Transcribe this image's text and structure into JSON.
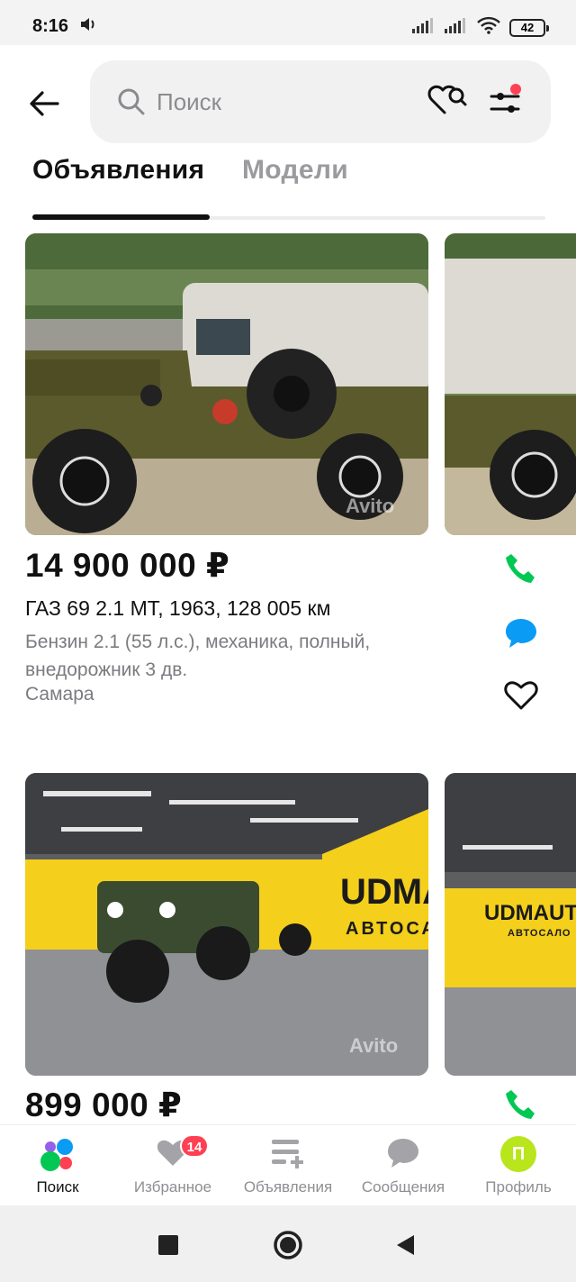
{
  "status_bar": {
    "time": "8:16",
    "battery": "42"
  },
  "search": {
    "placeholder": "Поиск"
  },
  "tabs": [
    {
      "label": "Объявления",
      "active": true
    },
    {
      "label": "Модели",
      "active": false
    }
  ],
  "listings": [
    {
      "price": "14 900 000 ₽",
      "title": "ГАЗ 69 2.1 MT, 1963, 128 005 км",
      "description": "Бензин 2.1 (55 л.с.), механика, полный, внедорожник 3 дв.",
      "location": "Самара",
      "watermark": "Avito"
    },
    {
      "price": "899 000 ₽",
      "banner_text": "UDMA",
      "banner_subtext": "АВТОСА",
      "banner_text_2": "UDMAUT",
      "banner_subtext_2": "АВТОСАЛО",
      "watermark": "Avito"
    }
  ],
  "bottom_nav": [
    {
      "label": "Поиск",
      "active": true
    },
    {
      "label": "Избранное",
      "badge": "14"
    },
    {
      "label": "Объявления"
    },
    {
      "label": "Сообщения"
    },
    {
      "label": "Профиль",
      "avatar_letter": "П"
    }
  ],
  "colors": {
    "call_green": "#00c853",
    "message_blue": "#0a9bf5",
    "badge_red": "#ff4053",
    "avatar_green": "#b8e51b",
    "banner_yellow": "#f4cf1c"
  }
}
